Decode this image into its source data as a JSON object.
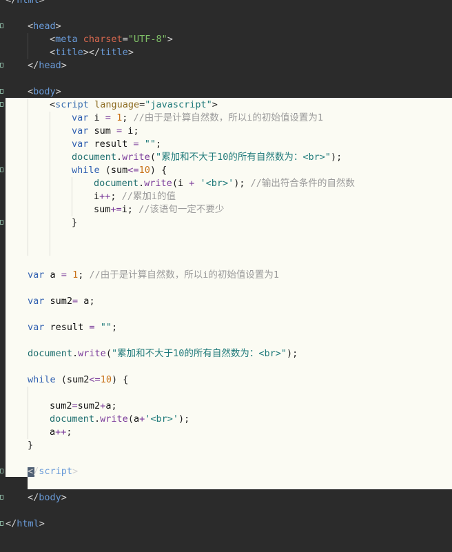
{
  "editor": {
    "language": "html",
    "theme_colors": {
      "background": "#2b2b2b",
      "highlight_block": "#fbfbf3",
      "tag": "#6a9bd8",
      "attribute": "#d9684f",
      "string": "#7fbf67",
      "keyword": "#6fa8dc",
      "number": "#e6a85a",
      "comment": "#8a8a8a"
    },
    "lines": [
      {
        "indent": 0,
        "theme": "dark",
        "fold": false,
        "partial": true,
        "tokens": [
          [
            "punct",
            "</"
          ],
          [
            "tag",
            "html"
          ],
          [
            "punct",
            ">"
          ]
        ]
      },
      {
        "indent": 0,
        "theme": "dark",
        "fold": false,
        "tokens": []
      },
      {
        "indent": 1,
        "theme": "dark",
        "fold": true,
        "tokens": [
          [
            "punct",
            "<"
          ],
          [
            "tag",
            "head"
          ],
          [
            "punct",
            ">"
          ]
        ]
      },
      {
        "indent": 2,
        "theme": "dark",
        "fold": false,
        "tokens": [
          [
            "punct",
            "<"
          ],
          [
            "tag",
            "meta"
          ],
          [
            "punct",
            " "
          ],
          [
            "attr",
            "charset"
          ],
          [
            "punct",
            "="
          ],
          [
            "str",
            "\"UTF-8\""
          ],
          [
            "punct",
            ">"
          ]
        ]
      },
      {
        "indent": 2,
        "theme": "dark",
        "fold": false,
        "tokens": [
          [
            "punct",
            "<"
          ],
          [
            "tag",
            "title"
          ],
          [
            "punct",
            "></"
          ],
          [
            "tag",
            "title"
          ],
          [
            "punct",
            ">"
          ]
        ]
      },
      {
        "indent": 1,
        "theme": "dark",
        "fold": true,
        "tokens": [
          [
            "punct",
            "</"
          ],
          [
            "tag",
            "head"
          ],
          [
            "punct",
            ">"
          ]
        ]
      },
      {
        "indent": 0,
        "theme": "dark",
        "fold": false,
        "tokens": []
      },
      {
        "indent": 1,
        "theme": "dark",
        "fold": true,
        "tokens": [
          [
            "punct",
            "<"
          ],
          [
            "tag",
            "body"
          ],
          [
            "punct",
            ">"
          ]
        ]
      },
      {
        "indent": 2,
        "theme": "light",
        "fold": true,
        "tokens": [
          [
            "punct",
            "<"
          ],
          [
            "tag",
            "script"
          ],
          [
            "punct",
            " "
          ],
          [
            "attr",
            "language"
          ],
          [
            "punct",
            "="
          ],
          [
            "str",
            "\"javascript\""
          ],
          [
            "punct",
            ">"
          ]
        ]
      },
      {
        "indent": 3,
        "theme": "light",
        "fold": false,
        "tokens": [
          [
            "kw",
            "var"
          ],
          [
            "id",
            " i "
          ],
          [
            "op",
            "="
          ],
          [
            "id",
            " "
          ],
          [
            "num",
            "1"
          ],
          [
            "punct",
            "; "
          ],
          [
            "cmt",
            "//由于是计算自然数，所以i的初始值设置为1"
          ]
        ]
      },
      {
        "indent": 3,
        "theme": "light",
        "fold": false,
        "tokens": [
          [
            "kw",
            "var"
          ],
          [
            "id",
            " sum "
          ],
          [
            "op",
            "="
          ],
          [
            "id",
            " i"
          ],
          [
            "punct",
            ";"
          ]
        ]
      },
      {
        "indent": 3,
        "theme": "light",
        "fold": false,
        "tokens": [
          [
            "kw",
            "var"
          ],
          [
            "id",
            " result "
          ],
          [
            "op",
            "="
          ],
          [
            "id",
            " "
          ],
          [
            "str",
            "\"\""
          ],
          [
            "punct",
            ";"
          ]
        ]
      },
      {
        "indent": 3,
        "theme": "light",
        "fold": false,
        "tokens": [
          [
            "fn",
            "document"
          ],
          [
            "punct",
            "."
          ],
          [
            "prop",
            "write"
          ],
          [
            "punct",
            "("
          ],
          [
            "str",
            "\"累加和不大于10的所有自然数为：<br>\""
          ],
          [
            "punct",
            ");"
          ]
        ]
      },
      {
        "indent": 3,
        "theme": "light",
        "fold": true,
        "tokens": [
          [
            "kw",
            "while"
          ],
          [
            "punct",
            " ("
          ],
          [
            "id",
            "sum"
          ],
          [
            "op",
            "<="
          ],
          [
            "num",
            "10"
          ],
          [
            "punct",
            ") {"
          ]
        ]
      },
      {
        "indent": 4,
        "theme": "light",
        "fold": false,
        "tokens": [
          [
            "fn",
            "document"
          ],
          [
            "punct",
            "."
          ],
          [
            "prop",
            "write"
          ],
          [
            "punct",
            "("
          ],
          [
            "id",
            "i "
          ],
          [
            "op",
            "+"
          ],
          [
            "id",
            " "
          ],
          [
            "str",
            "'<br>'"
          ],
          [
            "punct",
            "); "
          ],
          [
            "cmt",
            "//输出符合条件的自然数"
          ]
        ]
      },
      {
        "indent": 4,
        "theme": "light",
        "fold": false,
        "tokens": [
          [
            "id",
            "i"
          ],
          [
            "op",
            "++"
          ],
          [
            "punct",
            "; "
          ],
          [
            "cmt",
            "//累加i的值"
          ]
        ]
      },
      {
        "indent": 4,
        "theme": "light",
        "fold": false,
        "tokens": [
          [
            "id",
            "sum"
          ],
          [
            "op",
            "+="
          ],
          [
            "id",
            "i"
          ],
          [
            "punct",
            "; "
          ],
          [
            "cmt",
            "//该语句一定不要少"
          ]
        ]
      },
      {
        "indent": 3,
        "theme": "light",
        "fold": true,
        "tokens": [
          [
            "punct",
            "}"
          ]
        ]
      },
      {
        "indent": 0,
        "theme": "light",
        "fold": false,
        "guides": 2,
        "tokens": []
      },
      {
        "indent": 0,
        "theme": "light",
        "fold": false,
        "guides": 2,
        "tokens": []
      },
      {
        "indent": 0,
        "theme": "light",
        "fold": false,
        "tokens": []
      },
      {
        "indent": 1,
        "theme": "light",
        "fold": false,
        "tokens": [
          [
            "kw",
            "var"
          ],
          [
            "id",
            " a "
          ],
          [
            "op",
            "="
          ],
          [
            "id",
            " "
          ],
          [
            "num",
            "1"
          ],
          [
            "punct",
            "; "
          ],
          [
            "cmt",
            "//由于是计算自然数，所以i的初始值设置为1"
          ]
        ]
      },
      {
        "indent": 0,
        "theme": "light",
        "fold": false,
        "tokens": []
      },
      {
        "indent": 1,
        "theme": "light",
        "fold": false,
        "tokens": [
          [
            "kw",
            "var"
          ],
          [
            "id",
            " sum2"
          ],
          [
            "op",
            "="
          ],
          [
            "id",
            " a"
          ],
          [
            "punct",
            ";"
          ]
        ]
      },
      {
        "indent": 0,
        "theme": "light",
        "fold": false,
        "tokens": []
      },
      {
        "indent": 1,
        "theme": "light",
        "fold": false,
        "tokens": [
          [
            "kw",
            "var"
          ],
          [
            "id",
            " result "
          ],
          [
            "op",
            "="
          ],
          [
            "id",
            " "
          ],
          [
            "str",
            "\"\""
          ],
          [
            "punct",
            ";"
          ]
        ]
      },
      {
        "indent": 0,
        "theme": "light",
        "fold": false,
        "tokens": []
      },
      {
        "indent": 1,
        "theme": "light",
        "fold": false,
        "tokens": [
          [
            "fn",
            "document"
          ],
          [
            "punct",
            "."
          ],
          [
            "prop",
            "write"
          ],
          [
            "punct",
            "("
          ],
          [
            "str",
            "\"累加和不大于10的所有自然数为：<br>\""
          ],
          [
            "punct",
            ");"
          ]
        ]
      },
      {
        "indent": 0,
        "theme": "light",
        "fold": false,
        "tokens": []
      },
      {
        "indent": 1,
        "theme": "light",
        "fold": false,
        "tokens": [
          [
            "kw",
            "while"
          ],
          [
            "punct",
            " ("
          ],
          [
            "id",
            "sum2"
          ],
          [
            "op",
            "<="
          ],
          [
            "num",
            "10"
          ],
          [
            "punct",
            ") {"
          ]
        ]
      },
      {
        "indent": 0,
        "theme": "light",
        "fold": false,
        "guides": 1,
        "tokens": []
      },
      {
        "indent": 2,
        "theme": "light",
        "fold": false,
        "tokens": [
          [
            "id",
            "sum2"
          ],
          [
            "op",
            "="
          ],
          [
            "id",
            "sum2"
          ],
          [
            "op",
            "+"
          ],
          [
            "id",
            "a"
          ],
          [
            "punct",
            ";"
          ]
        ]
      },
      {
        "indent": 2,
        "theme": "light",
        "fold": false,
        "tokens": [
          [
            "fn",
            "document"
          ],
          [
            "punct",
            "."
          ],
          [
            "prop",
            "write"
          ],
          [
            "punct",
            "("
          ],
          [
            "id",
            "a"
          ],
          [
            "op",
            "+"
          ],
          [
            "str",
            "'<br>'"
          ],
          [
            "punct",
            ");"
          ]
        ]
      },
      {
        "indent": 2,
        "theme": "light",
        "fold": false,
        "tokens": [
          [
            "id",
            "a"
          ],
          [
            "op",
            "++"
          ],
          [
            "punct",
            ";"
          ]
        ]
      },
      {
        "indent": 1,
        "theme": "light",
        "fold": false,
        "tokens": [
          [
            "punct",
            "}"
          ]
        ]
      },
      {
        "indent": 0,
        "theme": "light",
        "fold": false,
        "tokens": []
      },
      {
        "indent": 1,
        "theme": "dark",
        "fold": true,
        "selected_start": true,
        "tokens": [
          [
            "punct",
            "</"
          ],
          [
            "tag",
            "script"
          ],
          [
            "punct",
            ">"
          ]
        ]
      },
      {
        "indent": 0,
        "theme": "dark",
        "fold": false,
        "tokens": []
      },
      {
        "indent": 1,
        "theme": "dark",
        "fold": true,
        "tokens": [
          [
            "punct",
            "</"
          ],
          [
            "tag",
            "body"
          ],
          [
            "punct",
            ">"
          ]
        ]
      },
      {
        "indent": 0,
        "theme": "dark",
        "fold": false,
        "tokens": []
      },
      {
        "indent": 0,
        "theme": "dark",
        "fold": true,
        "tokens": [
          [
            "punct",
            "</"
          ],
          [
            "tag",
            "html"
          ],
          [
            "punct",
            ">"
          ]
        ]
      }
    ]
  }
}
